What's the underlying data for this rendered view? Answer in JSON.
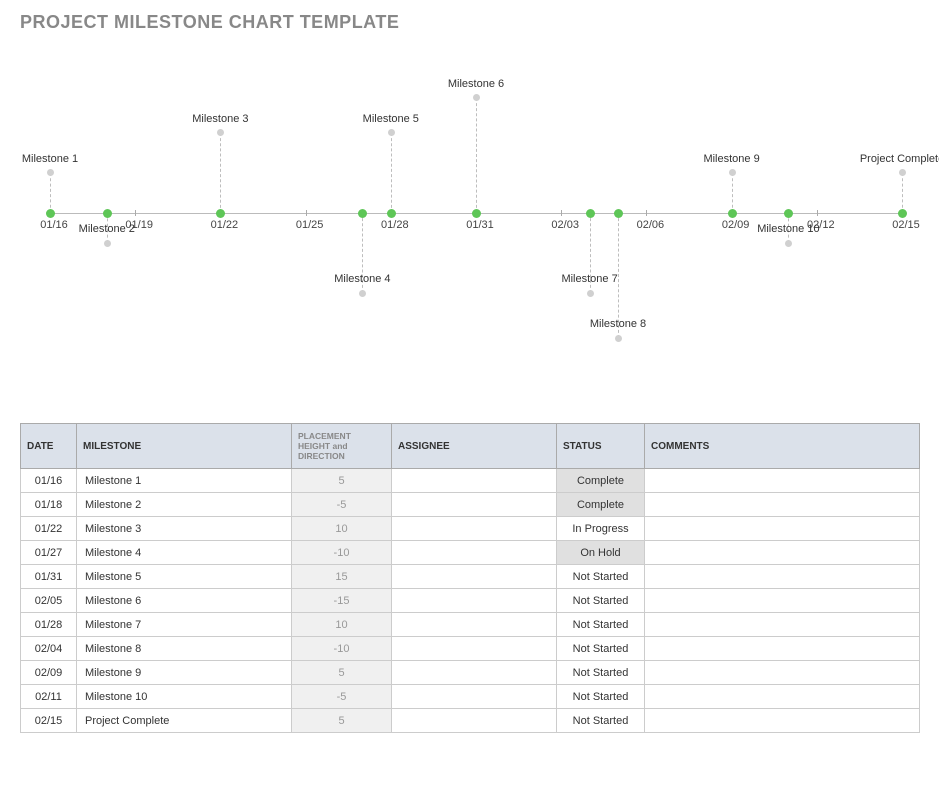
{
  "title": "PROJECT MILESTONE CHART TEMPLATE",
  "chart_data": {
    "type": "scatter",
    "title": "",
    "xlabel": "",
    "ylabel": "",
    "x_ticks": [
      "01/16",
      "01/19",
      "01/22",
      "01/25",
      "01/28",
      "01/31",
      "02/03",
      "02/06",
      "02/09",
      "02/12",
      "02/15"
    ],
    "series": [
      {
        "name": "milestones",
        "points": [
          {
            "date": "01/16",
            "label": "Milestone 1",
            "height": 5
          },
          {
            "date": "01/18",
            "label": "Milestone 2",
            "height": -5
          },
          {
            "date": "01/22",
            "label": "Milestone 3",
            "height": 10
          },
          {
            "date": "01/27",
            "label": "Milestone 4",
            "height": -10
          },
          {
            "date": "01/28",
            "label": "Milestone 5",
            "height": 10
          },
          {
            "date": "01/31",
            "label": "Milestone 6",
            "height": 15
          },
          {
            "date": "02/04",
            "label": "Milestone 7",
            "height": -10
          },
          {
            "date": "02/05",
            "label": "Milestone 8",
            "height": -15
          },
          {
            "date": "02/09",
            "label": "Milestone 9",
            "height": 5
          },
          {
            "date": "02/11",
            "label": "Milestone 10",
            "height": -5
          },
          {
            "date": "02/15",
            "label": "Project Complete",
            "height": 5
          }
        ]
      }
    ]
  },
  "table": {
    "headers": {
      "date": "DATE",
      "milestone": "MILESTONE",
      "height": "PLACEMENT HEIGHT and DIRECTION",
      "assignee": "ASSIGNEE",
      "status": "STATUS",
      "comments": "COMMENTS"
    },
    "rows": [
      {
        "date": "01/16",
        "milestone": "Milestone 1",
        "height": "5",
        "assignee": "",
        "status": "Complete",
        "comments": ""
      },
      {
        "date": "01/18",
        "milestone": "Milestone 2",
        "height": "-5",
        "assignee": "",
        "status": "Complete",
        "comments": ""
      },
      {
        "date": "01/22",
        "milestone": "Milestone 3",
        "height": "10",
        "assignee": "",
        "status": "In Progress",
        "comments": ""
      },
      {
        "date": "01/27",
        "milestone": "Milestone 4",
        "height": "-10",
        "assignee": "",
        "status": "On Hold",
        "comments": ""
      },
      {
        "date": "01/31",
        "milestone": "Milestone 5",
        "height": "15",
        "assignee": "",
        "status": "Not Started",
        "comments": ""
      },
      {
        "date": "02/05",
        "milestone": "Milestone 6",
        "height": "-15",
        "assignee": "",
        "status": "Not Started",
        "comments": ""
      },
      {
        "date": "01/28",
        "milestone": "Milestone 7",
        "height": "10",
        "assignee": "",
        "status": "Not Started",
        "comments": ""
      },
      {
        "date": "02/04",
        "milestone": "Milestone 8",
        "height": "-10",
        "assignee": "",
        "status": "Not Started",
        "comments": ""
      },
      {
        "date": "02/09",
        "milestone": "Milestone 9",
        "height": "5",
        "assignee": "",
        "status": "Not Started",
        "comments": ""
      },
      {
        "date": "02/11",
        "milestone": "Milestone 10",
        "height": "-5",
        "assignee": "",
        "status": "Not Started",
        "comments": ""
      },
      {
        "date": "02/15",
        "milestone": "Project Complete",
        "height": "5",
        "assignee": "",
        "status": "Not Started",
        "comments": ""
      }
    ]
  }
}
